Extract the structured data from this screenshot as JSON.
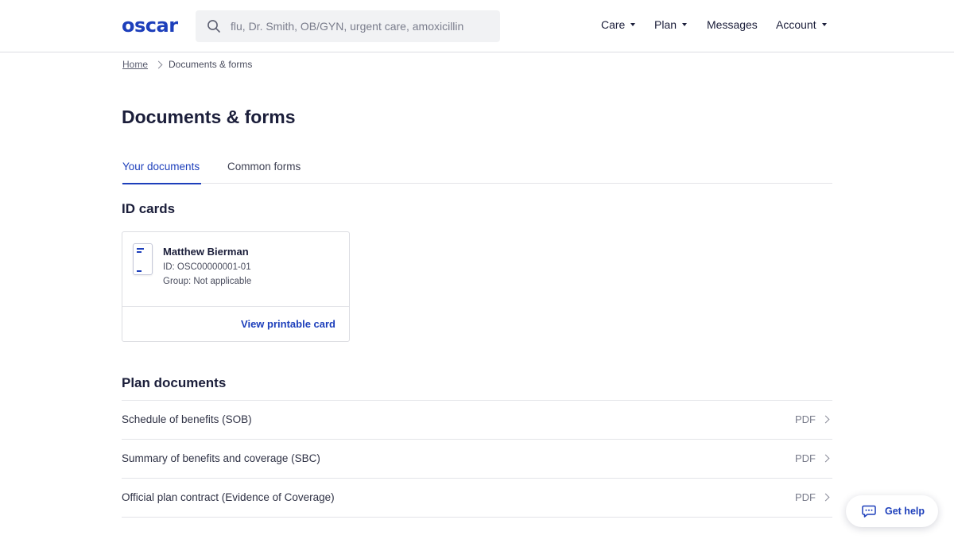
{
  "header": {
    "logo": "oscar",
    "search": {
      "placeholder": "flu, Dr. Smith, OB/GYN, urgent care, amoxicillin",
      "icon": "search-icon"
    },
    "nav": [
      {
        "label": "Care",
        "dropdown": true
      },
      {
        "label": "Plan",
        "dropdown": true
      },
      {
        "label": "Messages",
        "dropdown": false
      },
      {
        "label": "Account",
        "dropdown": true
      }
    ]
  },
  "breadcrumb": {
    "home": "Home",
    "current": "Documents & forms"
  },
  "page": {
    "title": "Documents & forms"
  },
  "tabs": [
    {
      "label": "Your documents",
      "active": true
    },
    {
      "label": "Common forms",
      "active": false
    }
  ],
  "id_cards": {
    "title": "ID cards",
    "card": {
      "name": "Matthew Bierman",
      "id_line": "ID: OSC00000001-01",
      "group_line": "Group: Not applicable",
      "link": "View printable card"
    }
  },
  "plan_documents": {
    "title": "Plan documents",
    "items": [
      {
        "label": "Schedule of benefits (SOB)",
        "format": "PDF"
      },
      {
        "label": "Summary of benefits and coverage (SBC)",
        "format": "PDF"
      },
      {
        "label": "Official plan contract (Evidence of Coverage)",
        "format": "PDF"
      }
    ]
  },
  "help": {
    "label": "Get help",
    "icon": "chat-icon"
  },
  "colors": {
    "brand": "#1d3fbb",
    "text": "#1b1e3a",
    "muted": "#7a7d8c",
    "border": "#e3e4e8"
  }
}
